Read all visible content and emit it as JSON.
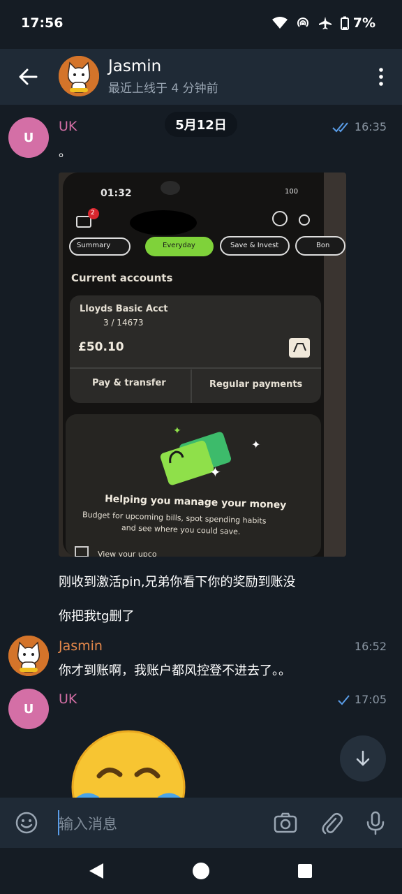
{
  "status_bar": {
    "time": "17:56",
    "battery": "7%"
  },
  "header": {
    "name": "Jasmin",
    "status": "最近上线于 4 分钟前"
  },
  "date_divider": "5月12日",
  "messages": [
    {
      "sender": "UK",
      "avatar_letter": "U",
      "time": "16:35",
      "text": "。",
      "read": true
    },
    {
      "caption1": "刚收到激活pin,兄弟你看下你的奖励到账没",
      "caption2": "你把我tg删了"
    },
    {
      "sender": "Jasmin",
      "time": "16:52",
      "text": "你才到账啊，我账户都风控登不进去了。。"
    },
    {
      "sender": "UK",
      "avatar_letter": "U",
      "time": "17:05",
      "read": false,
      "emoji": "face-with-tears-of-joy"
    }
  ],
  "photo": {
    "phone_time": "01:32",
    "battery": "100",
    "notification_count": "2",
    "tabs": [
      "Summary",
      "Everyday",
      "Save & Invest",
      "Bon"
    ],
    "section_title": "Current accounts",
    "account_name": "Lloyds Basic Acct",
    "account_number": "3 / 14673",
    "balance": "£50.10",
    "actions": [
      "Pay & transfer",
      "Regular payments"
    ],
    "promo_title": "Helping you manage your money",
    "promo_text_1": "Budget for upcoming bills, spot spending habits",
    "promo_text_2": "and see where you could save.",
    "bottom_text": "View your upco"
  },
  "input": {
    "placeholder": "输入消息"
  },
  "colors": {
    "background": "#151c24",
    "header": "#1f2a36",
    "uk": "#d46fa6",
    "jasmin": "#e6894b",
    "check": "#5a9de8"
  }
}
